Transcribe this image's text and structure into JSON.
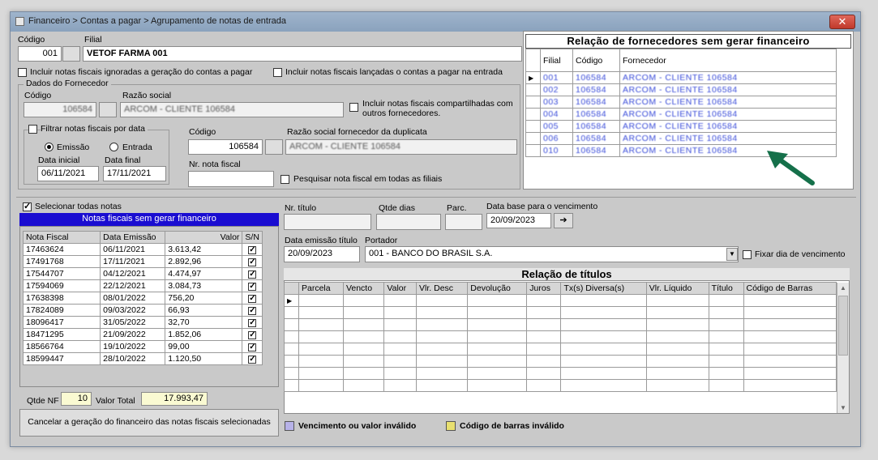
{
  "window": {
    "title": "Financeiro > Contas a pagar > Agrupamento de notas de entrada",
    "close_label": "✕"
  },
  "header": {
    "codigo_label": "Código",
    "codigo_value": "001",
    "filial_label": "Filial",
    "filial_value": "VETOF FARMA 001"
  },
  "options": {
    "incluir_ignoradas": "Incluir notas fiscais ignoradas a geração do contas a pagar",
    "incluir_lancadas": "Incluir notas fiscais lançadas o contas a pagar na entrada"
  },
  "fornecedor": {
    "group_label": "Dados do Fornecedor",
    "codigo_label": "Código",
    "codigo_value": "106584",
    "razao_label": "Razão social",
    "razao_value": "ARCOM - CLIENTE 106584",
    "compartilhadas_label": "Incluir notas fiscais compartilhadas com outros fornecedores."
  },
  "filtro_data": {
    "group_label": "Filtrar notas fiscais por data",
    "emissao_label": "Emissão",
    "entrada_label": "Entrada",
    "data_inicial_label": "Data inicial",
    "data_inicial_value": "06/11/2021",
    "data_final_label": "Data final",
    "data_final_value": "17/11/2021"
  },
  "duplicata": {
    "codigo_label": "Código",
    "codigo_value": "106584",
    "razao_label": "Razão social fornecedor da duplicata",
    "razao_value": "ARCOM - CLIENTE 106584",
    "nr_nota_label": "Nr. nota fiscal",
    "nr_nota_value": "",
    "pesquisar_label": "Pesquisar nota fiscal em todas as filiais"
  },
  "fornecedores_panel": {
    "title": "Relação de fornecedores sem gerar financeiro",
    "columns": [
      "Filial",
      "Código",
      "Fornecedor"
    ],
    "rows": [
      {
        "filial": "001",
        "codigo": "106584",
        "fornecedor": "ARCOM - CLIENTE 106584"
      },
      {
        "filial": "002",
        "codigo": "106584",
        "fornecedor": "ARCOM - CLIENTE 106584"
      },
      {
        "filial": "003",
        "codigo": "106584",
        "fornecedor": "ARCOM - CLIENTE 106584"
      },
      {
        "filial": "004",
        "codigo": "106584",
        "fornecedor": "ARCOM - CLIENTE 106584"
      },
      {
        "filial": "005",
        "codigo": "106584",
        "fornecedor": "ARCOM - CLIENTE 106584"
      },
      {
        "filial": "006",
        "codigo": "106584",
        "fornecedor": "ARCOM - CLIENTE 106584"
      },
      {
        "filial": "010",
        "codigo": "106584",
        "fornecedor": "ARCOM - CLIENTE 106584"
      }
    ]
  },
  "notas": {
    "selecionar_todas_label": "Selecionar todas notas",
    "title": "Notas fiscais sem gerar financeiro",
    "columns": [
      "Nota Fiscal",
      "Data Emissão",
      "Valor",
      "S/N"
    ],
    "rows": [
      {
        "nota": "17463624",
        "data": "06/11/2021",
        "valor": "3.613,42"
      },
      {
        "nota": "17491768",
        "data": "17/11/2021",
        "valor": "2.892,96"
      },
      {
        "nota": "17544707",
        "data": "04/12/2021",
        "valor": "4.474,97"
      },
      {
        "nota": "17594069",
        "data": "22/12/2021",
        "valor": "3.084,73"
      },
      {
        "nota": "17638398",
        "data": "08/01/2022",
        "valor": "756,20"
      },
      {
        "nota": "17824089",
        "data": "09/03/2022",
        "valor": "66,93"
      },
      {
        "nota": "18096417",
        "data": "31/05/2022",
        "valor": "32,70"
      },
      {
        "nota": "18471295",
        "data": "21/09/2022",
        "valor": "1.852,06"
      },
      {
        "nota": "18566764",
        "data": "19/10/2022",
        "valor": "99,00"
      },
      {
        "nota": "18599447",
        "data": "28/10/2022",
        "valor": "1.120,50"
      }
    ],
    "qtde_label": "Qtde NF",
    "qtde_value": "10",
    "valor_total_label": "Valor Total",
    "valor_total_value": "17.993,47",
    "cancelar_label": "Cancelar a geração do financeiro das notas fiscais selecionadas"
  },
  "titulo_form": {
    "nr_titulo_label": "Nr. título",
    "qtde_dias_label": "Qtde dias",
    "parc_label": "Parc.",
    "data_base_label": "Data base para o vencimento",
    "data_base_value": "20/09/2023",
    "data_emissao_label": "Data emissão título",
    "data_emissao_value": "20/09/2023",
    "portador_label": "Portador",
    "portador_value": "001 - BANCO DO BRASIL S.A.",
    "fixar_label": "Fixar dia de vencimento"
  },
  "titulos": {
    "title": "Relação de títulos",
    "columns": [
      "Parcela",
      "Vencto",
      "Valor",
      "Vlr. Desc",
      "Devolução",
      "Juros",
      "Tx(s) Diversa(s)",
      "Vlr. Líquido",
      "Título",
      "Código de Barras"
    ]
  },
  "legend": {
    "invalid_value_label": "Vencimento ou valor inválido",
    "invalid_value_color": "#b7b2e8",
    "invalid_barcode_label": "Código de barras inválido",
    "invalid_barcode_color": "#e8e070"
  },
  "colors": {
    "notas_header_bg": "#1a0dd1",
    "arrow": "#15704a"
  }
}
